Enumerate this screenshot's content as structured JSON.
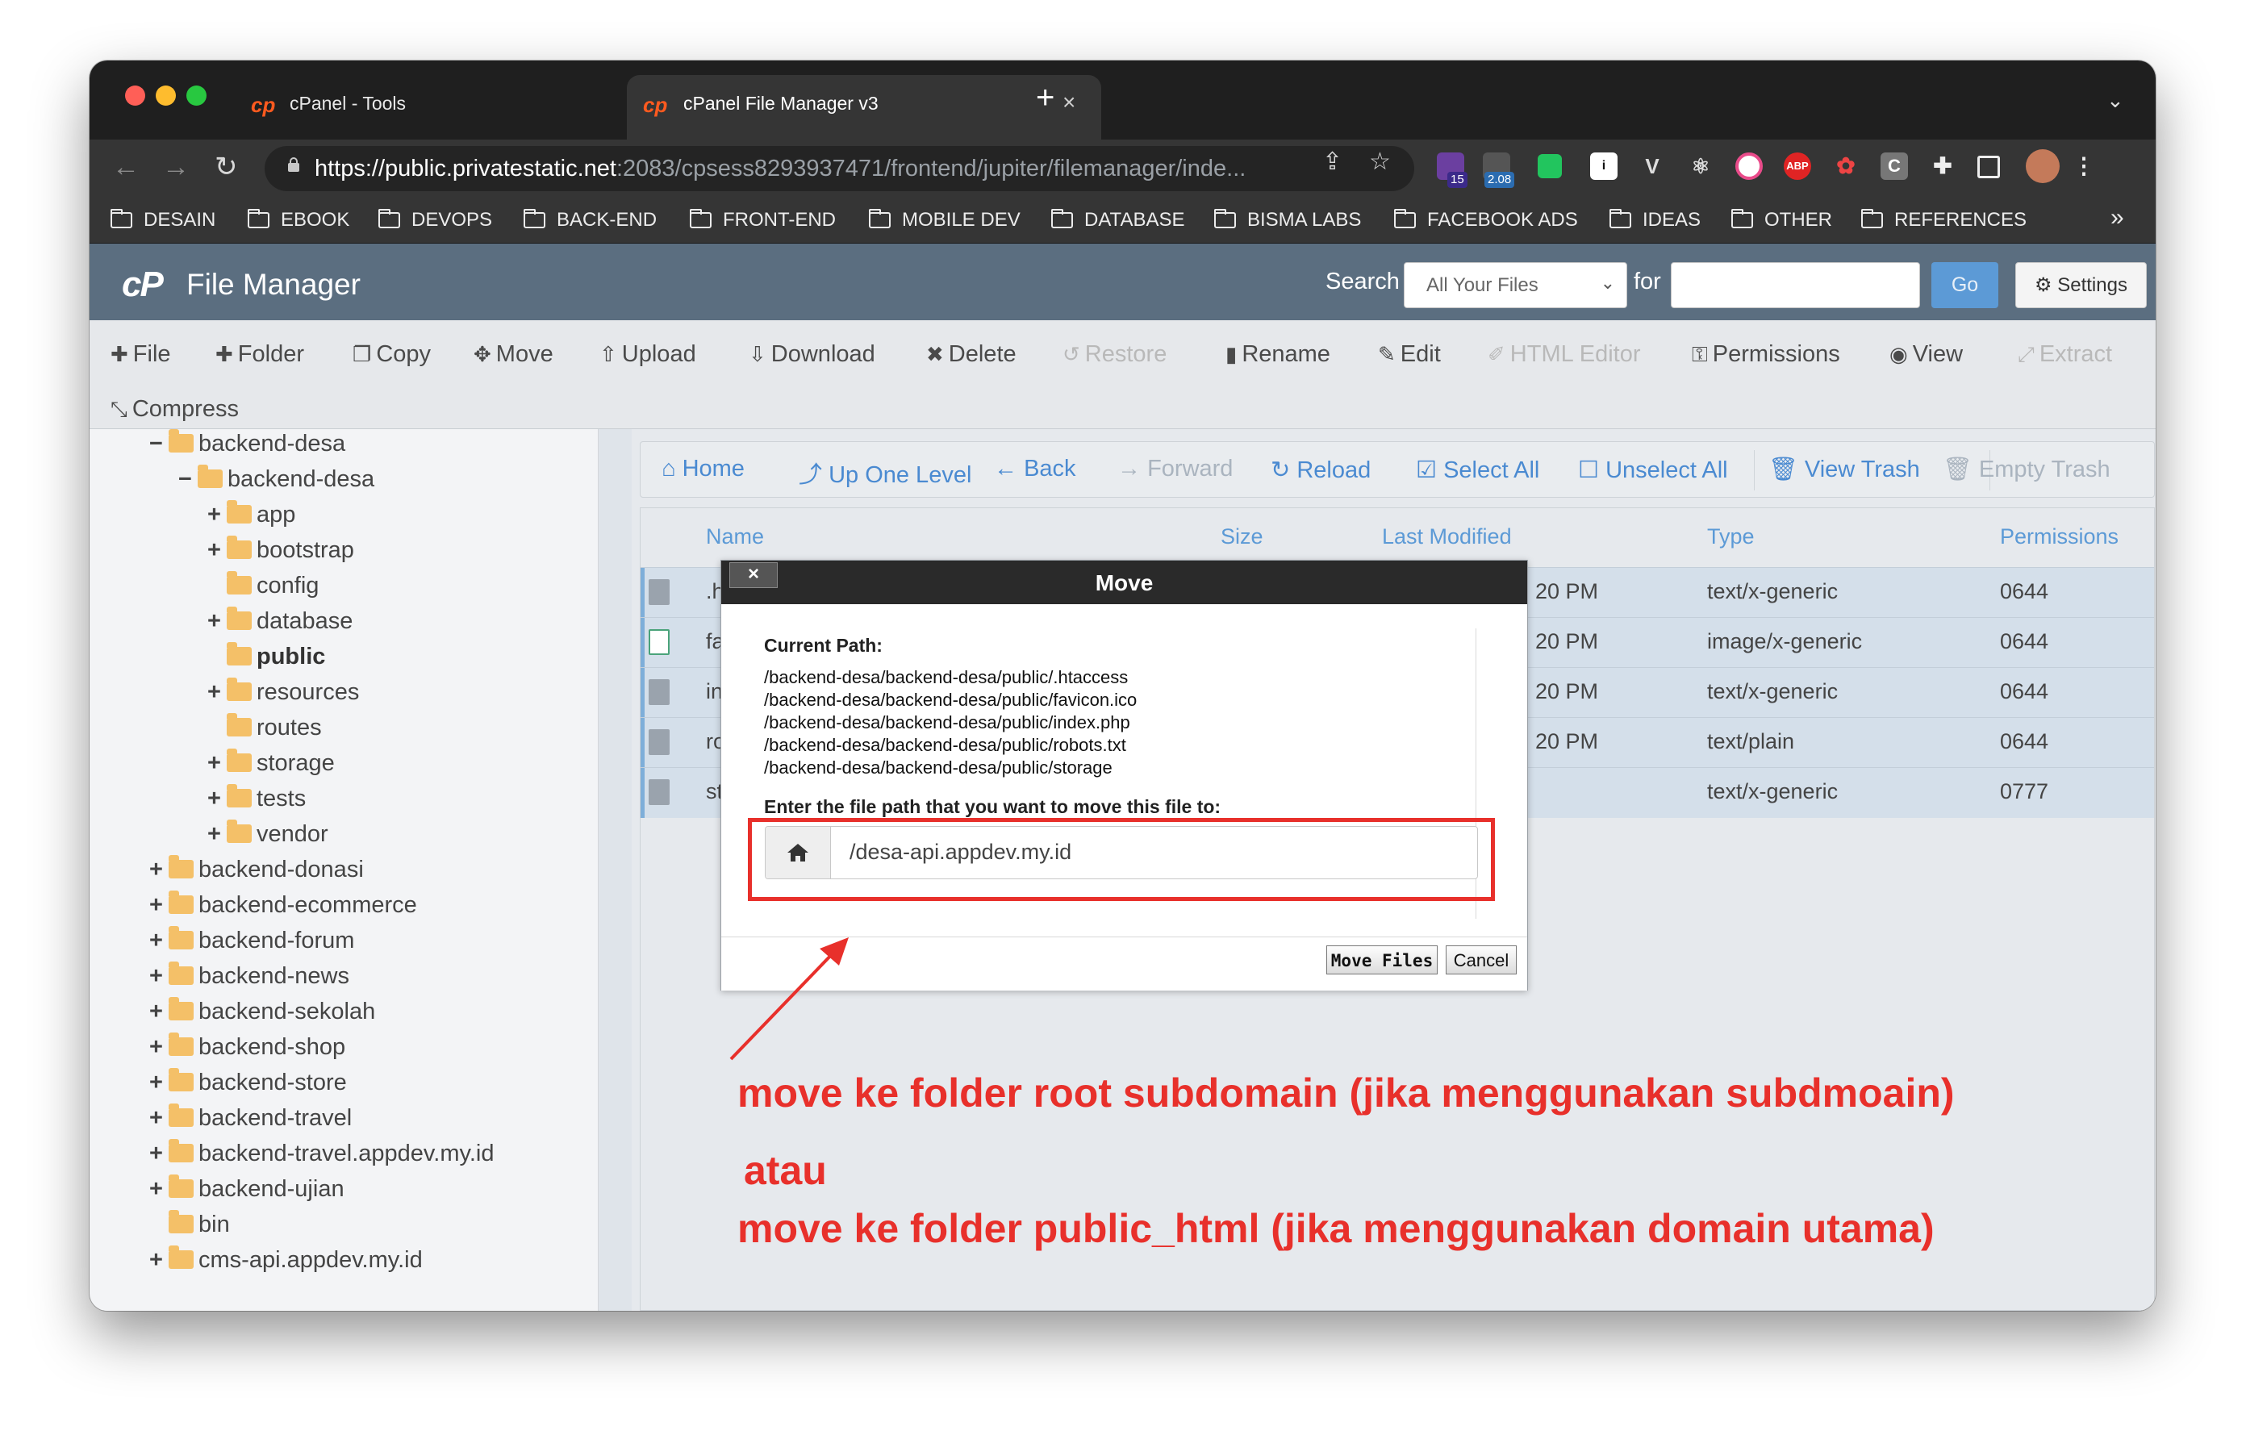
{
  "browser": {
    "tabs": [
      {
        "label": "cPanel - Tools",
        "icon": "cp"
      },
      {
        "label": "cPanel File Manager v3",
        "icon": "cp"
      }
    ],
    "url_host": "https://public.privatestatic.net",
    "url_rest": ":2083/cpsess8293937471/frontend/jupiter/filemanager/inde...",
    "ext_badges": {
      "a": "15",
      "b": "2.08"
    },
    "ext_abp": "ABP",
    "ext_c": "C",
    "bookmarks": [
      "DESAIN",
      "EBOOK",
      "DEVOPS",
      "BACK-END",
      "FRONT-END",
      "MOBILE DEV",
      "DATABASE",
      "BISMA LABS",
      "FACEBOOK ADS",
      "IDEAS",
      "OTHER",
      "REFERENCES"
    ],
    "bookmarks_more": "»"
  },
  "header": {
    "logo": "cP",
    "title": "File Manager",
    "search_label": "Search",
    "search_scope": "All Your Files",
    "for_label": "for",
    "search_value": "",
    "go_label": "Go",
    "settings_label": "Settings"
  },
  "actions": {
    "file": "File",
    "folder": "Folder",
    "copy": "Copy",
    "move": "Move",
    "upload": "Upload",
    "download": "Download",
    "delete": "Delete",
    "restore": "Restore",
    "rename": "Rename",
    "edit": "Edit",
    "html_editor": "HTML Editor",
    "permissions": "Permissions",
    "view": "View",
    "extract": "Extract",
    "compress": "Compress"
  },
  "tree": [
    {
      "label": "backend-desa",
      "toggle": "−"
    },
    {
      "label": "backend-desa",
      "toggle": "−"
    },
    {
      "label": "app",
      "toggle": "+"
    },
    {
      "label": "bootstrap",
      "toggle": "+"
    },
    {
      "label": "config",
      "toggle": ""
    },
    {
      "label": "database",
      "toggle": "+"
    },
    {
      "label": "public",
      "toggle": ""
    },
    {
      "label": "resources",
      "toggle": "+"
    },
    {
      "label": "routes",
      "toggle": ""
    },
    {
      "label": "storage",
      "toggle": "+"
    },
    {
      "label": "tests",
      "toggle": "+"
    },
    {
      "label": "vendor",
      "toggle": "+"
    },
    {
      "label": "backend-donasi",
      "toggle": "+"
    },
    {
      "label": "backend-ecommerce",
      "toggle": "+"
    },
    {
      "label": "backend-forum",
      "toggle": "+"
    },
    {
      "label": "backend-news",
      "toggle": "+"
    },
    {
      "label": "backend-sekolah",
      "toggle": "+"
    },
    {
      "label": "backend-shop",
      "toggle": "+"
    },
    {
      "label": "backend-store",
      "toggle": "+"
    },
    {
      "label": "backend-travel",
      "toggle": "+"
    },
    {
      "label": "backend-travel.appdev.my.id",
      "toggle": "+"
    },
    {
      "label": "backend-ujian",
      "toggle": "+"
    },
    {
      "label": "bin",
      "toggle": ""
    },
    {
      "label": "cms-api.appdev.my.id",
      "toggle": "+"
    }
  ],
  "nav": {
    "home": "Home",
    "up": "Up One Level",
    "back": "Back",
    "forward": "Forward",
    "reload": "Reload",
    "select_all": "Select All",
    "unselect_all": "Unselect All",
    "view_trash": "View Trash",
    "empty_trash": "Empty Trash"
  },
  "table": {
    "columns": {
      "name": "Name",
      "size": "Size",
      "modified": "Last Modified",
      "type": "Type",
      "perms": "Permissions"
    },
    "rows": [
      {
        "name": ".ht",
        "modified": "20 PM",
        "type": "text/x-generic",
        "perms": "0644",
        "icon": "file-icon"
      },
      {
        "name": "fav",
        "modified": "20 PM",
        "type": "image/x-generic",
        "perms": "0644",
        "icon": "image-file-icon"
      },
      {
        "name": "ind",
        "modified": "20 PM",
        "type": "text/x-generic",
        "perms": "0644",
        "icon": "file-icon"
      },
      {
        "name": "rob",
        "modified": "20 PM",
        "type": "text/plain",
        "perms": "0644",
        "icon": "file-icon"
      },
      {
        "name": "sto",
        "modified": "",
        "type": "text/x-generic",
        "perms": "0777",
        "icon": "symlink-file-icon"
      }
    ]
  },
  "modal": {
    "close": "×",
    "title": "Move",
    "current_path_label": "Current Path:",
    "paths": [
      "/backend-desa/backend-desa/public/.htaccess",
      "/backend-desa/backend-desa/public/favicon.ico",
      "/backend-desa/backend-desa/public/index.php",
      "/backend-desa/backend-desa/public/robots.txt",
      "/backend-desa/backend-desa/public/storage"
    ],
    "enter_label": "Enter the file path that you want to move this file to:",
    "destination": "/desa-api.appdev.my.id",
    "move_button": "Move Files",
    "cancel_button": "Cancel"
  },
  "annotation": {
    "line1": "move ke folder root subdomain (jika menggunakan subdmoain)",
    "line2": "atau",
    "line3": "move ke folder public_html (jika menggunakan domain utama)",
    "color": "#e8302b"
  }
}
